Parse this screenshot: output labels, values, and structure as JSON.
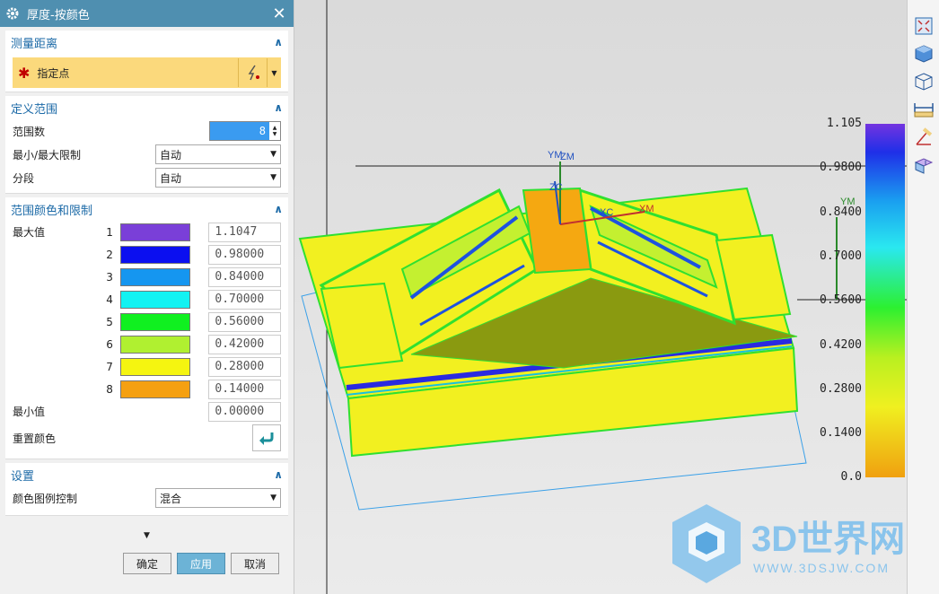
{
  "dialog": {
    "title": "厚度-按颜色",
    "sections": {
      "measure": {
        "title": "测量距离",
        "specify_point": "指定点"
      },
      "range": {
        "title": "定义范围",
        "count_label": "范围数",
        "count_value": "8",
        "minmax_label": "最小/最大限制",
        "minmax_value": "自动",
        "segment_label": "分段",
        "segment_value": "自动"
      },
      "colors": {
        "title": "范围颜色和限制",
        "max_label": "最大值",
        "min_label": "最小值",
        "min_value": "0.00000",
        "reset_label": "重置颜色",
        "rows": [
          {
            "index": "1",
            "color": "#7a3fd8",
            "value": "1.1047"
          },
          {
            "index": "2",
            "color": "#0b0ff0",
            "value": "0.98000"
          },
          {
            "index": "3",
            "color": "#1596f0",
            "value": "0.84000"
          },
          {
            "index": "4",
            "color": "#12f2f2",
            "value": "0.70000"
          },
          {
            "index": "5",
            "color": "#10f020",
            "value": "0.56000"
          },
          {
            "index": "6",
            "color": "#b0f030",
            "value": "0.42000"
          },
          {
            "index": "7",
            "color": "#f5f510",
            "value": "0.28000"
          },
          {
            "index": "8",
            "color": "#f5a011",
            "value": "0.14000"
          }
        ]
      },
      "settings": {
        "title": "设置",
        "legend_label": "颜色图例控制",
        "legend_value": "混合"
      }
    },
    "buttons": {
      "ok": "确定",
      "apply": "应用",
      "cancel": "取消"
    }
  },
  "legend": {
    "values": [
      "1.105",
      "0.9800",
      "0.8400",
      "0.7000",
      "0.5600",
      "0.4200",
      "0.2800",
      "0.1400",
      "0.0"
    ]
  },
  "axes": {
    "ym": "YM",
    "zm": "ZM",
    "xm": "XM",
    "xc": "XC",
    "zc": "ZC"
  },
  "watermark": {
    "brand": "3D世界网",
    "url": "WWW.3DSJW.COM"
  },
  "icons": [
    "fit-view-icon",
    "shaded-view-icon",
    "wireframe-view-icon",
    "measure-distance-icon",
    "measure-angle-icon",
    "thickness-info-icon"
  ]
}
